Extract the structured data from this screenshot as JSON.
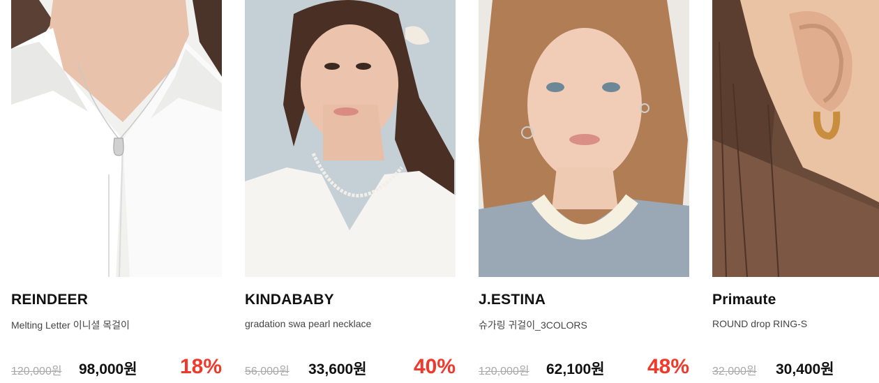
{
  "products": [
    {
      "brand": "REINDEER",
      "name": "Melting Letter 이니셜 목걸이",
      "original_price": "120,000원",
      "sale_price": "98,000원",
      "discount": "18%",
      "image_alt": "silver letter pendant necklace on model in white shirt"
    },
    {
      "brand": "KINDABABY",
      "name": "gradation swa pearl necklace",
      "original_price": "56,000원",
      "sale_price": "33,600원",
      "discount": "40%",
      "image_alt": "model wearing pearl necklace"
    },
    {
      "brand": "J.ESTINA",
      "name": "슈가링 귀걸이_3COLORS",
      "original_price": "120,000원",
      "sale_price": "62,100원",
      "discount": "48%",
      "image_alt": "model wearing small hoop earrings"
    },
    {
      "brand": "Primaute",
      "name": "ROUND drop RING-S",
      "original_price": "32,000원",
      "sale_price": "30,400원",
      "discount": "",
      "image_alt": "gold drop hoop earring close-up"
    }
  ],
  "colors": {
    "discount": "#f0382b",
    "strike": "#a8a8a8",
    "brand": "#111111"
  }
}
